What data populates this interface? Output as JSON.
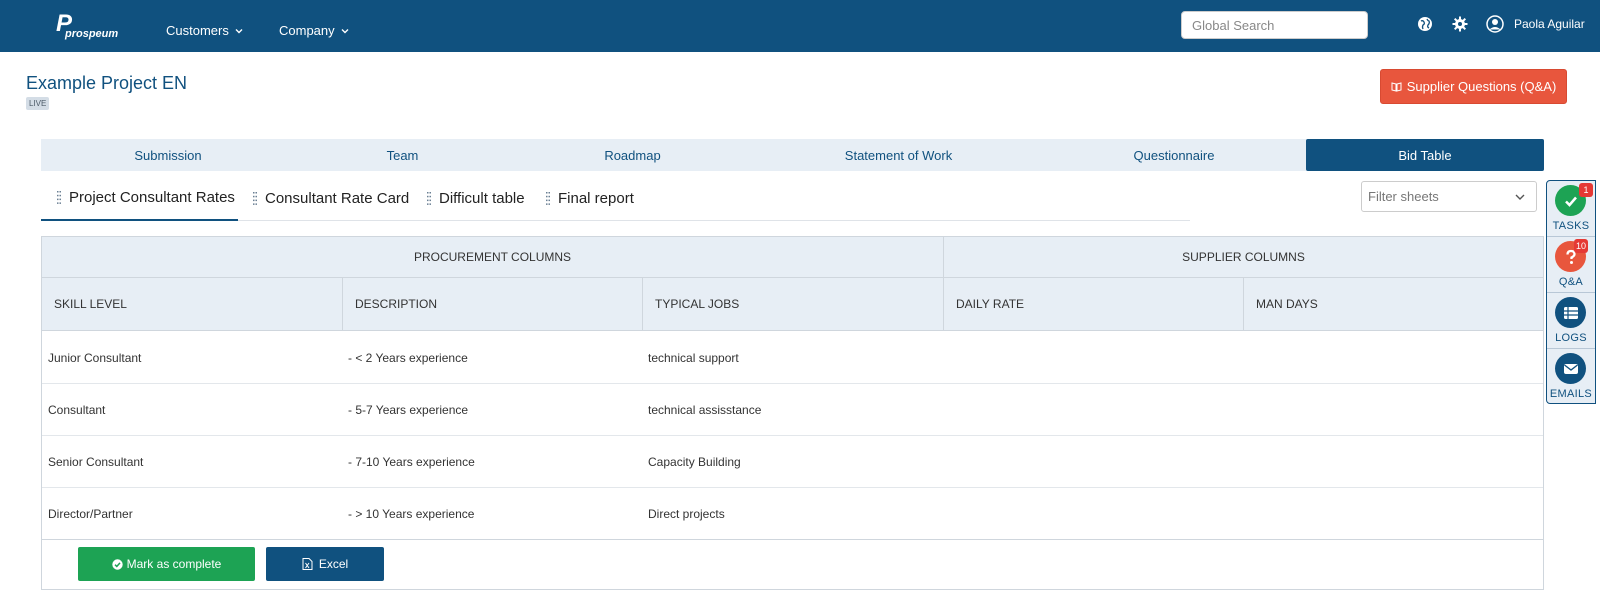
{
  "topbar": {
    "logo_mark": "P",
    "logo_text": "prospeum",
    "nav": [
      {
        "label": "Customers"
      },
      {
        "label": "Company"
      }
    ],
    "search": {
      "placeholder": "Global Search",
      "value": ""
    },
    "user_name": "Paola Aguilar"
  },
  "page": {
    "title": "Example Project EN",
    "status_badge": "LIVE",
    "qa_button": "Supplier Questions (Q&A)"
  },
  "main_tabs": [
    {
      "label": "Submission",
      "active": false
    },
    {
      "label": "Team",
      "active": false
    },
    {
      "label": "Roadmap",
      "active": false
    },
    {
      "label": "Statement of Work",
      "active": false
    },
    {
      "label": "Questionnaire",
      "active": false
    },
    {
      "label": "Bid Table",
      "active": true
    }
  ],
  "sheet_tabs": [
    {
      "label": "Project Consultant Rates",
      "active": true
    },
    {
      "label": "Consultant Rate Card",
      "active": false
    },
    {
      "label": "Difficult table",
      "active": false
    },
    {
      "label": "Final report",
      "active": false
    }
  ],
  "filter": {
    "placeholder": "Filter sheets"
  },
  "table": {
    "groups": [
      "PROCUREMENT COLUMNS",
      "SUPPLIER COLUMNS"
    ],
    "columns": [
      "SKILL LEVEL",
      "DESCRIPTION",
      "TYPICAL JOBS",
      "DAILY RATE",
      "MAN DAYS"
    ],
    "rows": [
      [
        "Junior Consultant",
        "- < 2 Years experience",
        "technical support",
        "",
        ""
      ],
      [
        "Consultant",
        "- 5-7 Years experience",
        "technical assisstance",
        "",
        ""
      ],
      [
        "Senior Consultant",
        "- 7-10 Years experience",
        "Capacity Building",
        "",
        ""
      ],
      [
        "Director/Partner",
        "- > 10 Years experience",
        "Direct projects",
        "",
        ""
      ]
    ]
  },
  "actions": {
    "complete_label": "Mark as complete",
    "excel_label": "Excel"
  },
  "side_panel": [
    {
      "label": "TASKS",
      "count": "1",
      "icon": "check-circle-icon",
      "color": "#1da354"
    },
    {
      "label": "Q&A",
      "count": "10",
      "icon": "question-icon",
      "color": "#e8563d"
    },
    {
      "label": "LOGS",
      "count": "",
      "icon": "list-icon",
      "color": "#10517f"
    },
    {
      "label": "EMAILS",
      "count": "",
      "icon": "envelope-icon",
      "color": "#10517f"
    }
  ],
  "colors": {
    "brand": "#10517f",
    "danger": "#e8563d",
    "success": "#1da354",
    "tab_bg": "#e7eef5"
  }
}
